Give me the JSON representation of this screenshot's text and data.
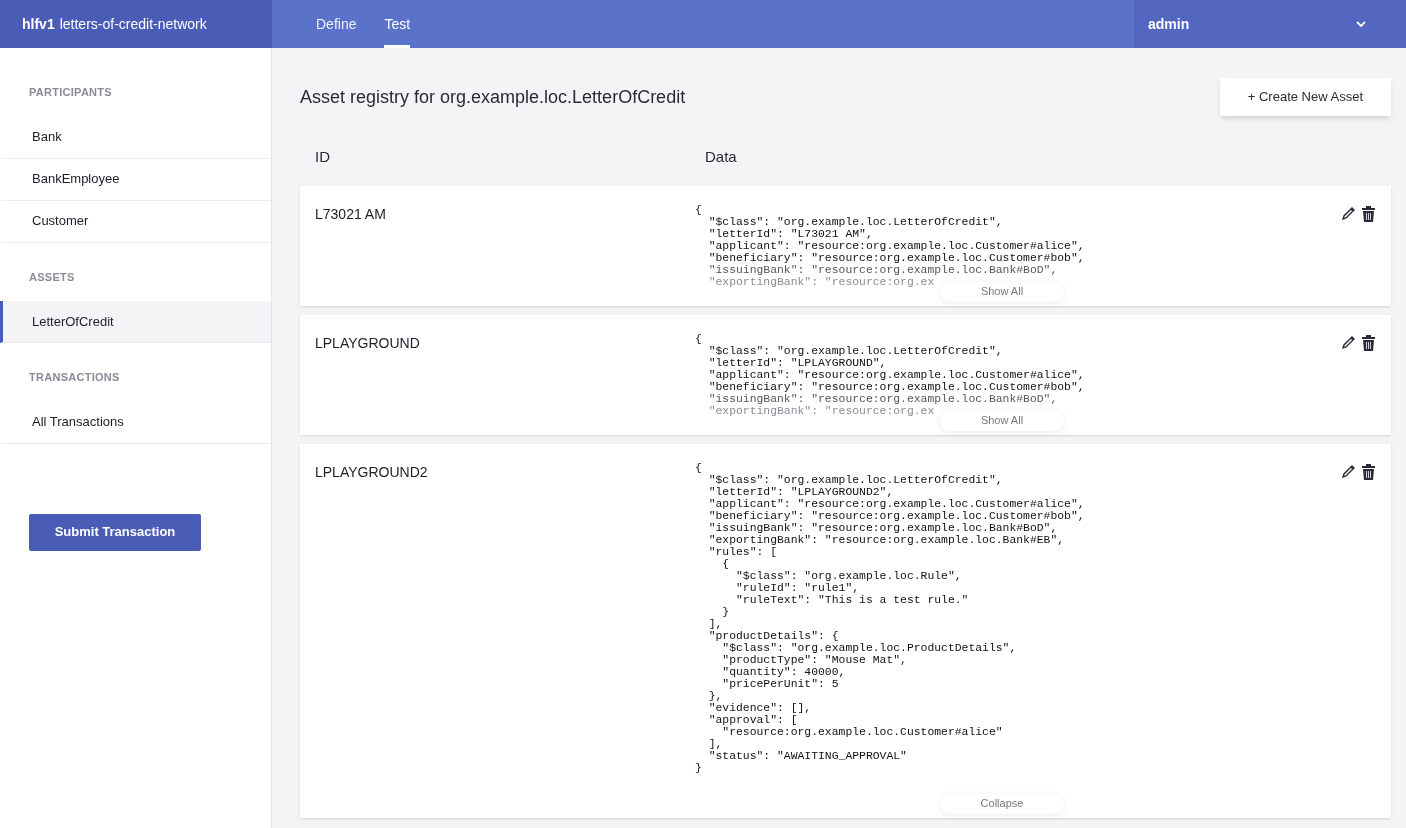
{
  "app": {
    "brand_bold": "hlfv1",
    "brand": "letters-of-credit-network"
  },
  "nav_tabs": [
    {
      "label": "Define",
      "selected": false
    },
    {
      "label": "Test",
      "selected": true
    }
  ],
  "user_menu": {
    "label": "admin"
  },
  "sidebar": {
    "sections": [
      {
        "heading": "PARTICIPANTS",
        "items": [
          {
            "label": "Bank",
            "selected": false
          },
          {
            "label": "BankEmployee",
            "selected": false
          },
          {
            "label": "Customer",
            "selected": false
          }
        ]
      },
      {
        "heading": "ASSETS",
        "items": [
          {
            "label": "LetterOfCredit",
            "selected": true
          }
        ]
      },
      {
        "heading": "TRANSACTIONS",
        "items": [
          {
            "label": "All Transactions",
            "selected": false
          }
        ]
      }
    ],
    "submit_button": "Submit Transaction"
  },
  "registry": {
    "title": "Asset registry for org.example.loc.LetterOfCredit",
    "create_button": "+ Create New Asset",
    "columns": [
      "ID",
      "Data"
    ],
    "rows": [
      {
        "id": "L73021 AM",
        "expanded": false,
        "toggle": "Show All",
        "data_lines": [
          "{",
          "  \"$class\": \"org.example.loc.LetterOfCredit\",",
          "  \"letterId\": \"L73021 AM\",",
          "  \"applicant\": \"resource:org.example.loc.Customer#alice\",",
          "  \"beneficiary\": \"resource:org.example.loc.Customer#bob\",",
          "  \"issuingBank\": \"resource:org.example.loc.Bank#BoD\",",
          "  \"exportingBank\": \"resource:org.ex"
        ]
      },
      {
        "id": "LPLAYGROUND",
        "expanded": false,
        "toggle": "Show All",
        "data_lines": [
          "{",
          "  \"$class\": \"org.example.loc.LetterOfCredit\",",
          "  \"letterId\": \"LPLAYGROUND\",",
          "  \"applicant\": \"resource:org.example.loc.Customer#alice\",",
          "  \"beneficiary\": \"resource:org.example.loc.Customer#bob\",",
          "  \"issuingBank\": \"resource:org.example.loc.Bank#BoD\",",
          "  \"exportingBank\": \"resource:org.ex"
        ]
      },
      {
        "id": "LPLAYGROUND2",
        "expanded": true,
        "toggle": "Collapse",
        "data_lines": [
          "{",
          "  \"$class\": \"org.example.loc.LetterOfCredit\",",
          "  \"letterId\": \"LPLAYGROUND2\",",
          "  \"applicant\": \"resource:org.example.loc.Customer#alice\",",
          "  \"beneficiary\": \"resource:org.example.loc.Customer#bob\",",
          "  \"issuingBank\": \"resource:org.example.loc.Bank#BoD\",",
          "  \"exportingBank\": \"resource:org.example.loc.Bank#EB\",",
          "  \"rules\": [",
          "    {",
          "      \"$class\": \"org.example.loc.Rule\",",
          "      \"ruleId\": \"rule1\",",
          "      \"ruleText\": \"This is a test rule.\"",
          "    }",
          "  ],",
          "  \"productDetails\": {",
          "    \"$class\": \"org.example.loc.ProductDetails\",",
          "    \"productType\": \"Mouse Mat\",",
          "    \"quantity\": 40000,",
          "    \"pricePerUnit\": 5",
          "  },",
          "  \"evidence\": [],",
          "  \"approval\": [",
          "    \"resource:org.example.loc.Customer#alice\"",
          "  ],",
          "  \"status\": \"AWAITING_APPROVAL\"",
          "}"
        ]
      }
    ]
  }
}
